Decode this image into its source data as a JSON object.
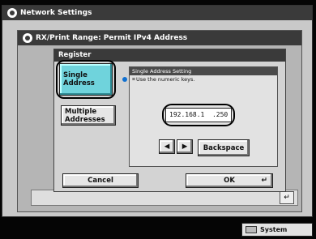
{
  "window1": {
    "title": "Network Settings"
  },
  "window2": {
    "title": "RX/Print Range: Permit IPv4 Address"
  },
  "register": {
    "title": "Register",
    "single_label": "Single\nAddress",
    "multiple_label": "Multiple\nAddresses",
    "panel_title": "Single Address Setting",
    "panel_hint": "Use the numeric keys.",
    "ip_value": "192.168.1  .250",
    "backspace_label": "Backspace",
    "cancel_label": "Cancel",
    "ok_label": "OK"
  },
  "status": {
    "system_monitor": "System Monitor"
  }
}
